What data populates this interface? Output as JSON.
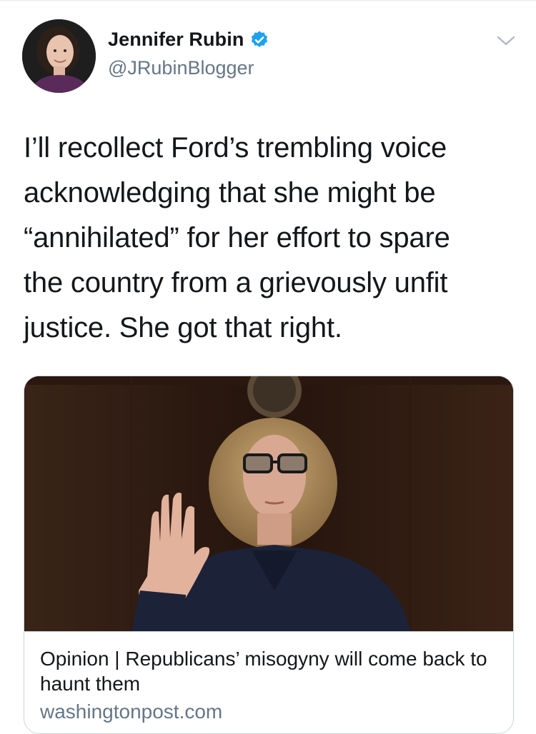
{
  "tweet": {
    "author": {
      "display_name": "Jennifer Rubin",
      "handle": "@JRubinBlogger",
      "verified": true,
      "avatar_icon": "user-avatar"
    },
    "menu_icon": "chevron-down-icon",
    "text_lines": [
      "I’ll recollect Ford’s trembling voice",
      "acknowledging that she might be",
      "“annihilated” for her effort to spare",
      "the country from a grievously unfit",
      "justice. She got that right."
    ],
    "link_card": {
      "title": "Opinion | Republicans’ misogyny will come back to haunt them",
      "domain": "washingtonpost.com"
    }
  },
  "colors": {
    "text_primary": "#14171a",
    "text_secondary": "#657786",
    "verified_blue": "#1da1f2",
    "border": "#ccd6dd"
  }
}
